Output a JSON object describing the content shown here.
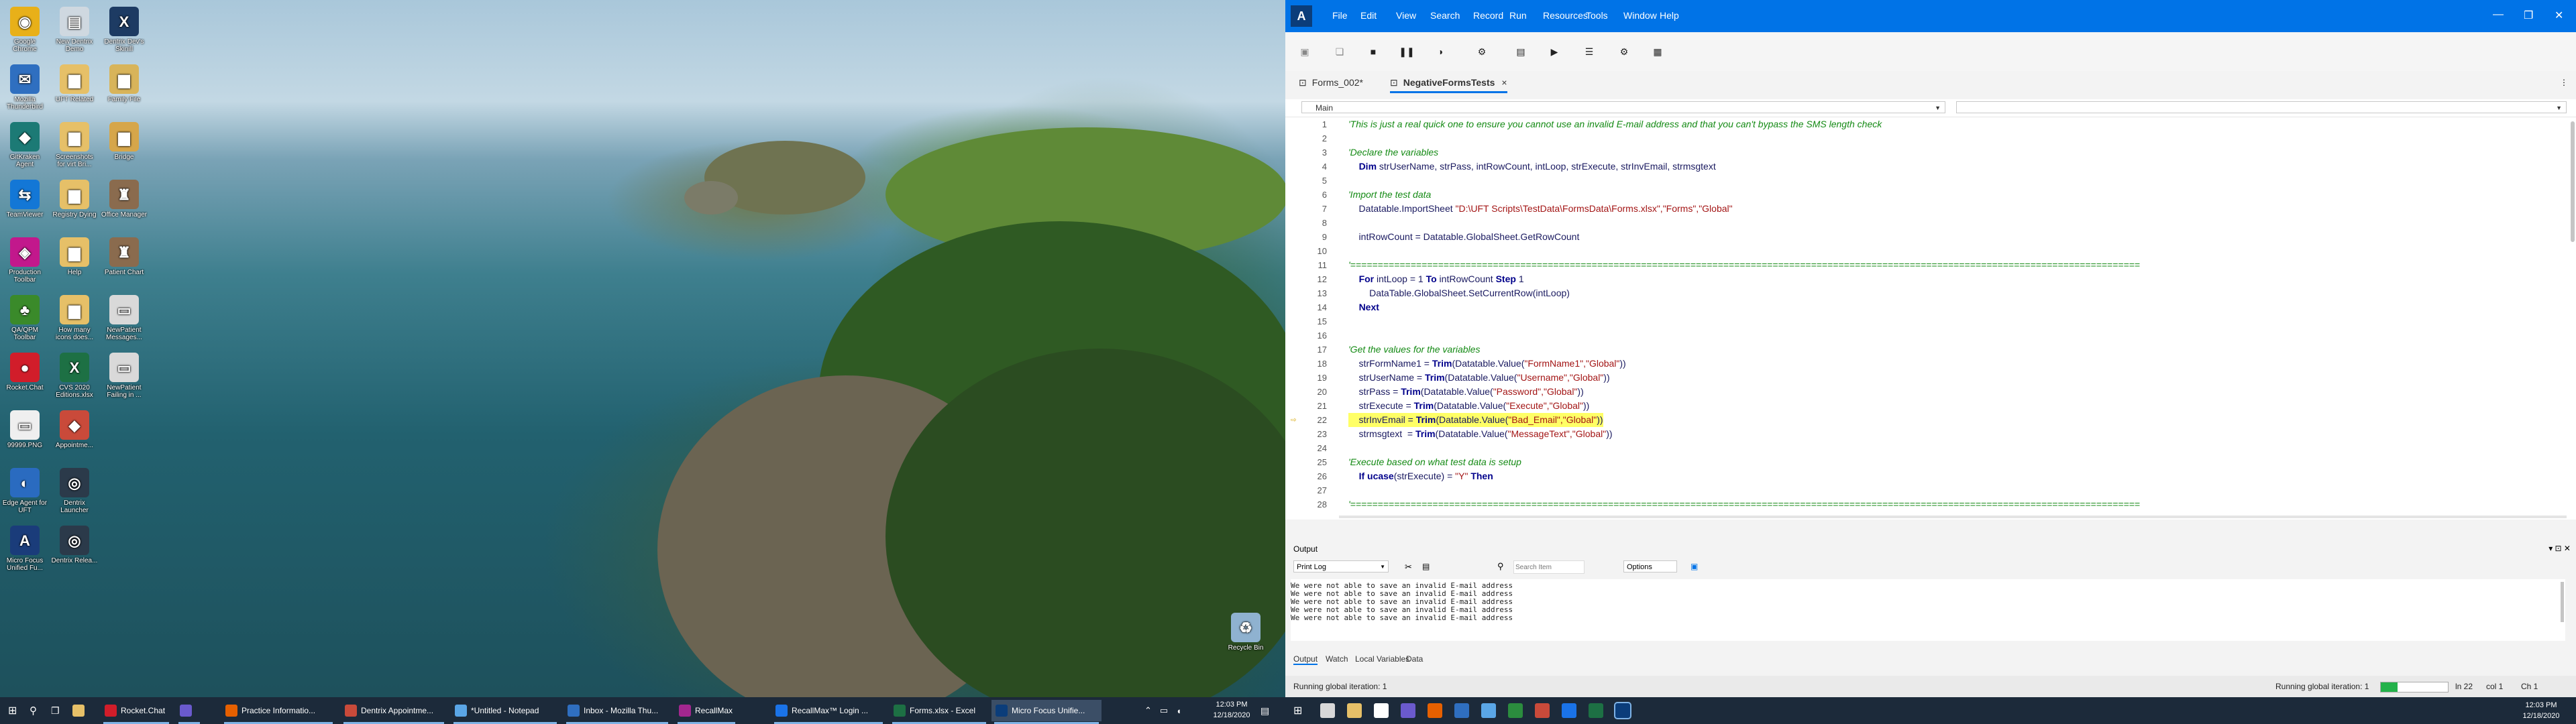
{
  "desktop": {
    "icons": [
      {
        "label": "Google Chrome",
        "color": "#e8b019",
        "glyph": "◉"
      },
      {
        "label": "New Dentrix Demo",
        "color": "#cfd8e0",
        "glyph": "▤"
      },
      {
        "label": "Dentrix Dev's Skinill",
        "color": "#1d3b63",
        "glyph": "X"
      },
      {
        "label": "Mozilla Thunderbird",
        "color": "#2f6fc0",
        "glyph": "✉"
      },
      {
        "label": "UFT Related",
        "color": "#e6c068",
        "glyph": "▆"
      },
      {
        "label": "Family File",
        "color": "#d8b45a",
        "glyph": "▆"
      },
      {
        "label": "GitKraken Agent",
        "color": "#1c7a75",
        "glyph": "◆"
      },
      {
        "label": "Screenshots for virt Bri...",
        "color": "#e6c068",
        "glyph": "▆"
      },
      {
        "label": "Bridge",
        "color": "#d6a64a",
        "glyph": "▆"
      },
      {
        "label": "TeamViewer",
        "color": "#1377d6",
        "glyph": "⇆"
      },
      {
        "label": "Registry Dying",
        "color": "#e6c068",
        "glyph": "▆"
      },
      {
        "label": "Office Manager",
        "color": "#8a6b4e",
        "glyph": "♜"
      },
      {
        "label": "Production Toolbar",
        "color": "#c2188c",
        "glyph": "◈"
      },
      {
        "label": "Help",
        "color": "#e6c068",
        "glyph": "▆"
      },
      {
        "label": "Patient Chart",
        "color": "#8a6b4e",
        "glyph": "♜"
      },
      {
        "label": "QA/QPM Toolbar",
        "color": "#3a8a2a",
        "glyph": "♣"
      },
      {
        "label": "How many icons does...",
        "color": "#e6c068",
        "glyph": "▆"
      },
      {
        "label": "NewPatient Messages...",
        "color": "#d9d9d9",
        "glyph": "▭"
      },
      {
        "label": "Rocket.Chat",
        "color": "#d11d2a",
        "glyph": "●"
      },
      {
        "label": "CVS 2020 Editions.xlsx",
        "color": "#1d7044",
        "glyph": "X"
      },
      {
        "label": "NewPatient Failing in ...",
        "color": "#d9d9d9",
        "glyph": "▭"
      },
      {
        "label": "99999.PNG",
        "color": "#efefef",
        "glyph": "▭"
      },
      {
        "label": "Appointme...",
        "color": "#c94a3a",
        "glyph": "◆"
      },
      {
        "label": "Edge Agent for UFT",
        "color": "#2a6bc0",
        "glyph": "◐"
      },
      {
        "label": "Dentrix Launcher",
        "color": "#2b3a4a",
        "glyph": "◎"
      },
      {
        "label": "Micro Focus Unified Fu...",
        "color": "#1a3c7a",
        "glyph": "A"
      },
      {
        "label": "Dentrix Relea...",
        "color": "#2b3a4a",
        "glyph": "◎"
      },
      {
        "label": "Recycle Bin",
        "color": "#8fb2d0",
        "glyph": "♻"
      }
    ],
    "taskbar": [
      {
        "label": "Rocket.Chat",
        "color": "#d11d2a"
      },
      {
        "label": "",
        "color": "#6a5acd"
      },
      {
        "label": "Practice Informatio...",
        "color": "#e66000"
      },
      {
        "label": "Dentrix Appointme...",
        "color": "#c94a3a"
      },
      {
        "label": "*Untitled - Notepad",
        "color": "#5aa6e6"
      },
      {
        "label": "Inbox - Mozilla Thu...",
        "color": "#2f6fc0"
      },
      {
        "label": "RecallMax",
        "color": "#a3278f"
      },
      {
        "label": "RecallMax™ Login ...",
        "color": "#1a73e8"
      },
      {
        "label": "Forms.xlsx - Excel",
        "color": "#1d7044"
      },
      {
        "label": "Micro Focus Unifie...",
        "color": "#0b3d7a"
      }
    ],
    "clock": {
      "time": "12:03 PM",
      "date": "12/18/2020"
    }
  },
  "uft": {
    "logo": "A",
    "menu": [
      "File",
      "Edit",
      "View",
      "Search",
      "Record",
      "Run",
      "Resources",
      "Tools",
      "Window",
      "Help"
    ],
    "tabs": [
      {
        "label": "Forms_002*"
      },
      {
        "label": "NegativeFormsTests",
        "close": "×"
      }
    ],
    "combo_left": "Main",
    "code": [
      [
        [
          "cm",
          "'This is just a real quick one to ensure you cannot use an invalid E-mail address and that you can't bypass the SMS length check"
        ]
      ],
      [],
      [
        [
          "cm",
          "'Declare the variables"
        ]
      ],
      [
        [
          "pl",
          "    "
        ],
        [
          "kw",
          "Dim"
        ],
        [
          "pl",
          " strUserName, strPass, intRowCount, intLoop, strExecute, strInvEmail, strmsgtext"
        ]
      ],
      [],
      [
        [
          "cm",
          "'Import the test data"
        ]
      ],
      [
        [
          "pl",
          "    Datatable.ImportSheet "
        ],
        [
          "str",
          "\"D:\\UFT Scripts\\TestData\\FormsData\\Forms.xlsx\",\"Forms\",\"Global\""
        ]
      ],
      [],
      [
        [
          "pl",
          "    intRowCount = Datatable.GlobalSheet.GetRowCount"
        ]
      ],
      [],
      [
        [
          "cm",
          "'================================================================================================================================================"
        ]
      ],
      [
        [
          "pl",
          "    "
        ],
        [
          "kw",
          "For"
        ],
        [
          "pl",
          " intLoop = 1 "
        ],
        [
          "kw",
          "To"
        ],
        [
          "pl",
          " intRowCount "
        ],
        [
          "kw",
          "Step"
        ],
        [
          "pl",
          " 1"
        ]
      ],
      [
        [
          "pl",
          "        DataTable.GlobalSheet.SetCurrentRow(intLoop)"
        ]
      ],
      [
        [
          "pl",
          "    "
        ],
        [
          "kw",
          "Next"
        ]
      ],
      [],
      [],
      [
        [
          "cm",
          "'Get the values for the variables"
        ]
      ],
      [
        [
          "pl",
          "    strFormName1 = "
        ],
        [
          "kw",
          "Trim"
        ],
        [
          "pl",
          "(Datatable.Value("
        ],
        [
          "str",
          "\"FormName1\",\"Global\""
        ],
        [
          "pl",
          "))"
        ]
      ],
      [
        [
          "pl",
          "    strUserName = "
        ],
        [
          "kw",
          "Trim"
        ],
        [
          "pl",
          "(Datatable.Value("
        ],
        [
          "str",
          "\"Username\",\"Global\""
        ],
        [
          "pl",
          "))"
        ]
      ],
      [
        [
          "pl",
          "    strPass = "
        ],
        [
          "kw",
          "Trim"
        ],
        [
          "pl",
          "(Datatable.Value("
        ],
        [
          "str",
          "\"Password\",\"Global\""
        ],
        [
          "pl",
          "))"
        ]
      ],
      [
        [
          "pl",
          "    strExecute = "
        ],
        [
          "kw",
          "Trim"
        ],
        [
          "pl",
          "(Datatable.Value("
        ],
        [
          "str",
          "\"Execute\",\"Global\""
        ],
        [
          "pl",
          "))"
        ]
      ],
      [
        [
          "pl",
          "    strInvEmail = "
        ],
        [
          "kw",
          "Trim"
        ],
        [
          "pl",
          "(Datatable.Value("
        ],
        [
          "str",
          "\"Bad_Email\",\"Global\""
        ],
        [
          "pl",
          "))"
        ]
      ],
      [
        [
          "pl",
          "    strmsgtext  = "
        ],
        [
          "kw",
          "Trim"
        ],
        [
          "pl",
          "(Datatable.Value("
        ],
        [
          "str",
          "\"MessageText\",\"Global\""
        ],
        [
          "pl",
          "))"
        ]
      ],
      [],
      [
        [
          "cm",
          "'Execute based on what test data is setup"
        ]
      ],
      [
        [
          "pl",
          "    "
        ],
        [
          "kw",
          "If"
        ],
        [
          "pl",
          " "
        ],
        [
          "kw",
          "ucase"
        ],
        [
          "pl",
          "(strExecute) = "
        ],
        [
          "str",
          "\"Y\""
        ],
        [
          "pl",
          " "
        ],
        [
          "kw",
          "Then"
        ]
      ],
      [],
      [
        [
          "cm",
          "'================================================================================================================================================"
        ]
      ]
    ],
    "highlight_line": 22,
    "output": {
      "title": "Output",
      "dropdown": "Print Log",
      "search_placeholder": "Search Item",
      "options_label": "Options",
      "lines": [
        "We were not able to save an invalid E-mail address",
        "We were not able to save an invalid E-mail address",
        "We were not able to save an invalid E-mail address",
        "We were not able to save an invalid E-mail address",
        "We were not able to save an invalid E-mail address"
      ],
      "tabs": [
        "Output",
        "Watch",
        "Local Variables",
        "Data"
      ]
    },
    "status": {
      "left": "Running global iteration: 1",
      "right_label": "Running global iteration: 1",
      "ln": "ln 22",
      "col": "col 1",
      "ch": "Ch 1",
      "progress": 0.25
    },
    "clock": {
      "time": "12:03 PM",
      "date": "12/18/2020"
    }
  }
}
